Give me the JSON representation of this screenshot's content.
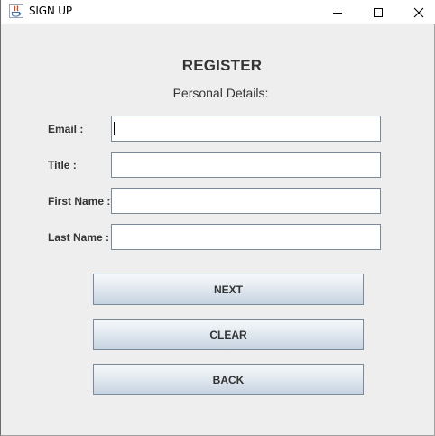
{
  "window": {
    "title": "SIGN UP"
  },
  "form": {
    "heading": "REGISTER",
    "subheading": "Personal Details:",
    "fields": [
      {
        "label": "Email :",
        "value": ""
      },
      {
        "label": "Title :",
        "value": ""
      },
      {
        "label": "First Name :",
        "value": ""
      },
      {
        "label": "Last Name :",
        "value": ""
      }
    ]
  },
  "buttons": {
    "next": "NEXT",
    "clear": "CLEAR",
    "back": "BACK"
  },
  "icons": {
    "app": "java-app-icon",
    "minimize": "minimize-icon",
    "maximize": "maximize-icon",
    "close": "close-icon"
  }
}
